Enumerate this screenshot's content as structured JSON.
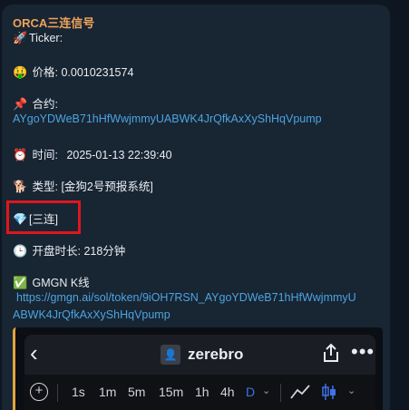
{
  "message": {
    "sender": "ORCA三连信号",
    "ticker_label": "Ticker:",
    "price_label": "价格:",
    "price_value": "0.0010231574",
    "contract_label": "合约:",
    "contract_address": "AYgoYDWeB71hHfWwjmmyUABWK4JrQfkAxXyShHqVpump",
    "time_label": "时间:",
    "time_value": "2025-01-13 22:39:40",
    "type_label": "类型:",
    "type_value": "[金狗2号预报系统]",
    "signal_tag": "[三连]",
    "duration_label": "开盘时长:",
    "duration_value": "218分钟",
    "kline_label": "GMGN K线",
    "kline_url_line1": "https://gmgn.ai/sol/token/9iOH7RSN_AYgoYDWeB71hHfWwjmmyU",
    "kline_url_line2": "ABWK4JrQfkAxXyShHqVpump"
  },
  "icons": {
    "ticker": "rocket-icon",
    "price": "money-face-icon",
    "contract": "pushpin-icon",
    "time": "alarm-clock-icon",
    "type": "dog-icon",
    "signal": "gem-icon",
    "duration": "clock-icon",
    "kline": "check-mark-icon"
  },
  "embed": {
    "title": "zerebro",
    "timeframes": [
      "1s",
      "1m",
      "5m",
      "15m",
      "1h",
      "4h",
      "D"
    ],
    "active_timeframe": "D"
  },
  "colors": {
    "background": "#0e1621",
    "bubble": "#182533",
    "sender": "#f0a35b",
    "link": "#4ba4e0",
    "highlight": "#e0161d",
    "active_timeframe": "#3f72e8"
  }
}
